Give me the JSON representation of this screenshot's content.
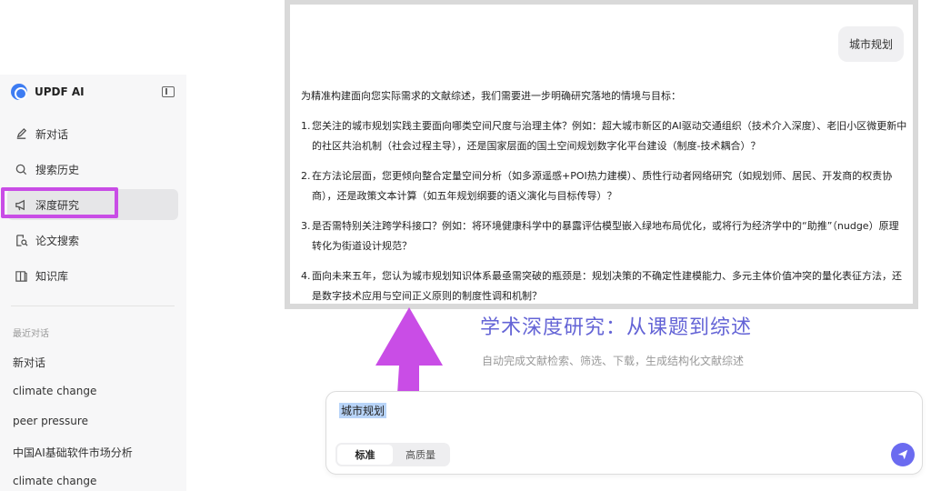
{
  "sidebar": {
    "brand": "UPDF AI",
    "nav": [
      {
        "label": "新对话",
        "icon": "edit-icon"
      },
      {
        "label": "搜索历史",
        "icon": "search-icon"
      },
      {
        "label": "深度研究",
        "icon": "megaphone-icon"
      },
      {
        "label": "论文搜索",
        "icon": "doc-search-icon"
      },
      {
        "label": "知识库",
        "icon": "book-icon"
      }
    ],
    "recent_title": "最近对话",
    "recent": [
      "新对话",
      "climate change",
      "peer pressure",
      "中国AI基础软件市场分析",
      "climate change"
    ]
  },
  "chat": {
    "user_message": "城市规划",
    "intro": "为精准构建面向您实际需求的文献综述，我们需要进一步明确研究落地的情境与目标：",
    "items": [
      {
        "num": "1.",
        "text": "您关注的城市规划实践主要面向哪类空间尺度与治理主体？例如：超大城市新区的AI驱动交通组织（技术介入深度）、老旧小区微更新中的社区共治机制（社会过程主导），还是国家层面的国土空间规划数字化平台建设（制度-技术耦合）？"
      },
      {
        "num": "2.",
        "text": "在方法论层面，您更倾向整合定量空间分析（如多源遥感+POI热力建模）、质性行动者网络研究（如规划师、居民、开发商的权责协商），还是政策文本计算（如五年规划纲要的语义演化与目标传导）？"
      },
      {
        "num": "3.",
        "text": "是否需特别关注跨学科接口？例如：将环境健康科学中的暴露评估模型嵌入绿地布局优化，或将行为经济学中的“助推”（nudge）原理转化为街道设计规范？"
      },
      {
        "num": "4.",
        "text": "面向未来五年，您认为城市规划知识体系最亟需突破的瓶颈是：规划决策的不确定性建模能力、多元主体价值冲突的量化表征方法，还是数字技术应用与空间正义原则的制度性调和机制？"
      }
    ]
  },
  "hero": {
    "title": "学术深度研究：从课题到综述",
    "subtitle": "自动完成文献检索、筛选、下载，生成结构化文献综述"
  },
  "input": {
    "value": "城市规划",
    "modes": [
      "标准",
      "高质量"
    ],
    "selected_mode": "标准"
  },
  "colors": {
    "accent": "#6b6bf0",
    "highlight": "#c94de6",
    "hero": "#6464d6"
  }
}
